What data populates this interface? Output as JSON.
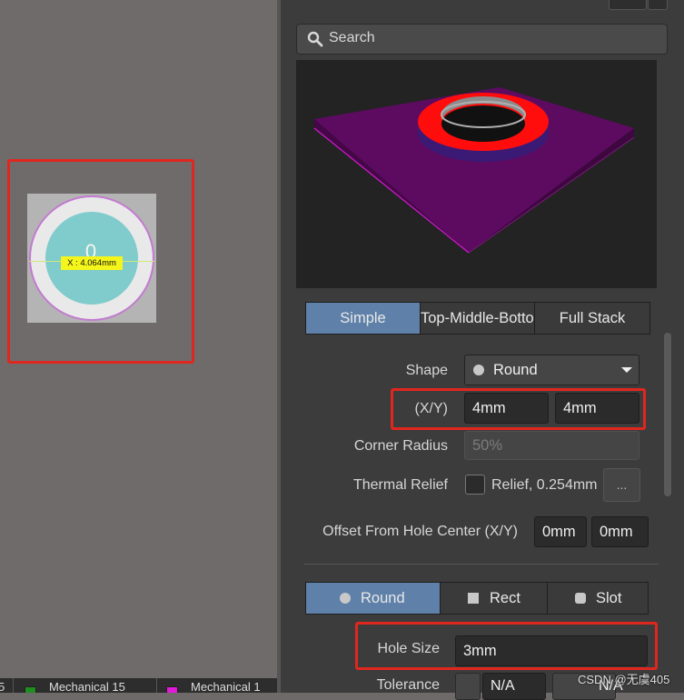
{
  "canvas": {
    "pad_marker": "0",
    "dimension_label": "X : 4.064mm"
  },
  "layer_tabs": [
    {
      "label": "5",
      "color": "#1f8d1f"
    },
    {
      "label": "Mechanical 15",
      "color": "#1f8d1f"
    },
    {
      "label": "Mechanical 1",
      "color": "#e01ad8"
    }
  ],
  "panel": {
    "search_placeholder": "Search",
    "pad_stack_tabs": [
      "Simple",
      "Top-Middle-Bottom",
      "Full Stack"
    ],
    "pad_stack_active": "Simple",
    "shape": {
      "label": "Shape",
      "value": "Round"
    },
    "size": {
      "label": "(X/Y)",
      "x": "4mm",
      "y": "4mm"
    },
    "corner_radius": {
      "label": "Corner Radius",
      "value": "50%"
    },
    "thermal_relief": {
      "label": "Thermal Relief",
      "value": "Relief, 0.254mm",
      "button": "..."
    },
    "offset": {
      "label": "Offset From Hole Center (X/Y)",
      "x": "0mm",
      "y": "0mm"
    },
    "hole_shape_tabs": [
      "Round",
      "Rect",
      "Slot"
    ],
    "hole_shape_active": "Round",
    "hole_size": {
      "label": "Hole Size",
      "value": "3mm"
    },
    "tolerance": {
      "label": "Tolerance",
      "value_a": "N/A",
      "value_b": "N/A"
    }
  },
  "watermark": "CSDN @无虞405",
  "colors": {
    "accent": "#5f81a9",
    "highlight_box": "#e0271f",
    "pad_ring_3d": "#ff0d0d",
    "board_3d": "#5a0b5c"
  }
}
